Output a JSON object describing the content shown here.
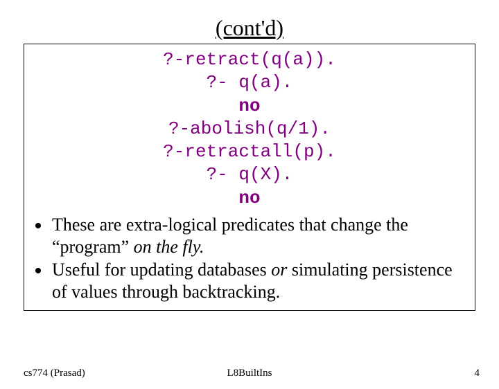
{
  "title": "(cont'd)",
  "code": {
    "l1": "?-retract(q(a)).",
    "l2": "?- q(a).",
    "l3": "no",
    "l4": "?-abolish(q/1).",
    "l5": "?-retractall(p).",
    "l6": "?- q(X).",
    "l7": "no"
  },
  "bullet1_a": "These are extra-logical predicates that change the “program” ",
  "bullet1_b": "on the fly.",
  "bullet2_a": "Useful for updating databases ",
  "bullet2_b": "or",
  "bullet2_c": " simulating persistence of values through backtracking.",
  "footer": {
    "left": "cs774 (Prasad)",
    "center": "L8BuiltIns",
    "right": "4"
  }
}
